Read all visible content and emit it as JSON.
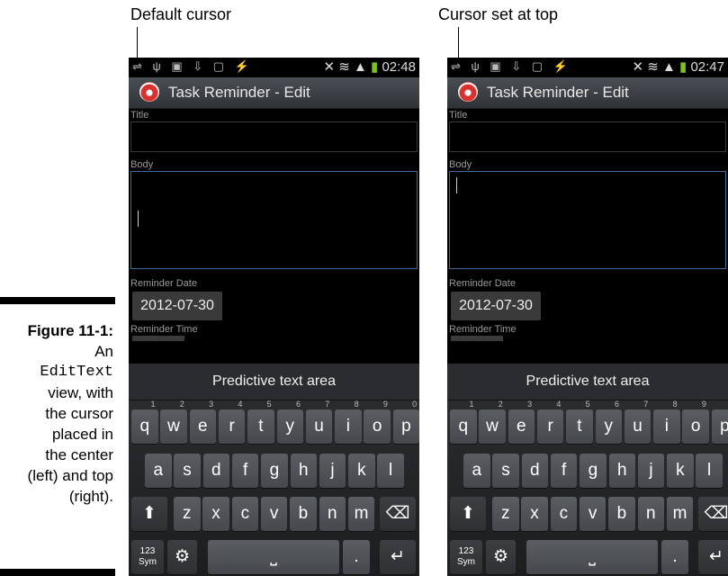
{
  "labels": {
    "left": "Default cursor",
    "right": "Cursor set at top"
  },
  "caption": {
    "figure": "Figure 11-1:",
    "line1": "An",
    "mono": "EditText",
    "line2": "view, with",
    "line3": "the cursor",
    "line4": "placed in",
    "line5": "the center",
    "line6": "(left) and top",
    "line7": "(right)."
  },
  "phones": [
    {
      "status_icons": "⇌ ψ ▣ ⇩ ▢ ⚡",
      "status_right_icons": "✕ ≋ ▲",
      "time": "02:48",
      "app_title": "Task Reminder - Edit",
      "title_label": "Title",
      "body_label": "Body",
      "date_label": "Reminder Date",
      "date_value": "2012-07-30",
      "time_label": "Reminder Time",
      "predictive": "Predictive text area"
    },
    {
      "status_icons": "⇌ ψ ▣ ⇩ ▢ ⚡",
      "status_right_icons": "✕ ≋ ▲",
      "time": "02:47",
      "app_title": "Task Reminder - Edit",
      "title_label": "Title",
      "body_label": "Body",
      "date_label": "Reminder Date",
      "date_value": "2012-07-30",
      "time_label": "Reminder Time",
      "predictive": "Predictive text area"
    }
  ],
  "keyboard": {
    "row1": [
      {
        "k": "q",
        "n": "1"
      },
      {
        "k": "w",
        "n": "2"
      },
      {
        "k": "e",
        "n": "3"
      },
      {
        "k": "r",
        "n": "4"
      },
      {
        "k": "t",
        "n": "5"
      },
      {
        "k": "y",
        "n": "6"
      },
      {
        "k": "u",
        "n": "7"
      },
      {
        "k": "i",
        "n": "8"
      },
      {
        "k": "o",
        "n": "9"
      },
      {
        "k": "p",
        "n": "0"
      }
    ],
    "row2": [
      "a",
      "s",
      "d",
      "f",
      "g",
      "h",
      "j",
      "k",
      "l"
    ],
    "row3": [
      "z",
      "x",
      "c",
      "v",
      "b",
      "n",
      "m"
    ],
    "shift": "⬆",
    "backspace": "⌫",
    "sym": "123\nSym",
    "settings": "⚙",
    "space": "⎵",
    "period": ".",
    "enter": "↵"
  }
}
